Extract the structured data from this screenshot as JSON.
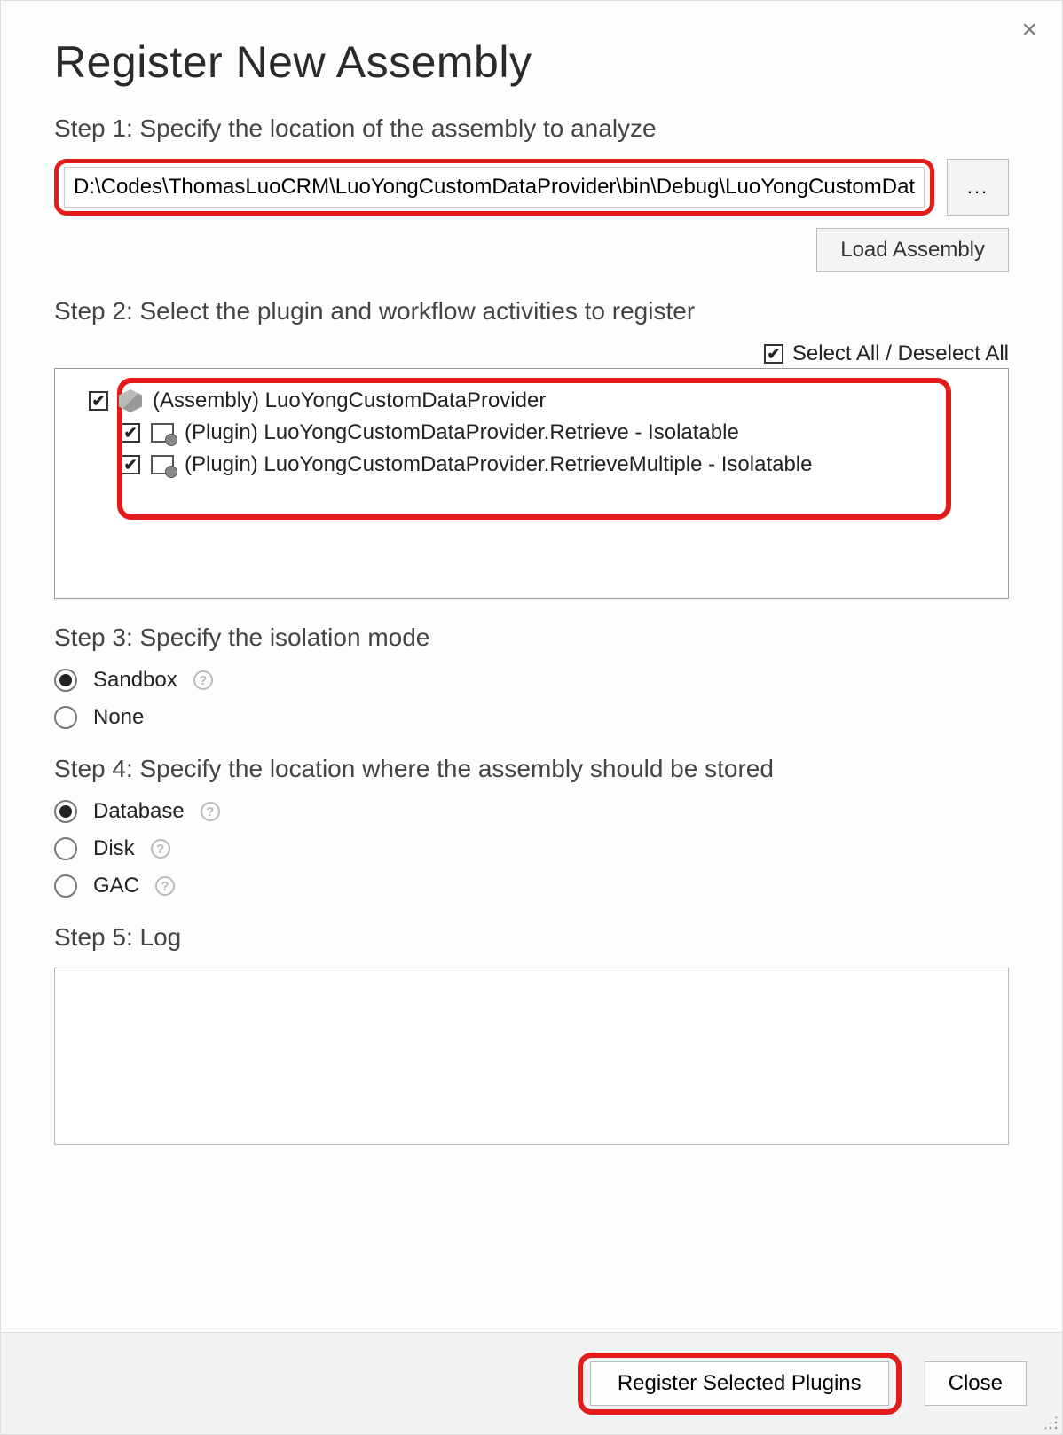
{
  "title": "Register New Assembly",
  "close_x": "×",
  "step1": {
    "label": "Step 1: Specify the location of the assembly to analyze",
    "path": "D:\\Codes\\ThomasLuoCRM\\LuoYongCustomDataProvider\\bin\\Debug\\LuoYongCustomDataProv",
    "browse": "...",
    "load_button": "Load Assembly"
  },
  "step2": {
    "label": "Step 2: Select the plugin and workflow activities to register",
    "select_all_label": "Select All / Deselect All",
    "select_all_checked": true,
    "tree": {
      "assembly": {
        "checked": true,
        "label": "(Assembly) LuoYongCustomDataProvider"
      },
      "plugins": [
        {
          "checked": true,
          "label": "(Plugin) LuoYongCustomDataProvider.Retrieve - Isolatable"
        },
        {
          "checked": true,
          "label": "(Plugin) LuoYongCustomDataProvider.RetrieveMultiple - Isolatable"
        }
      ]
    }
  },
  "step3": {
    "label": "Step 3: Specify the isolation mode",
    "options": [
      {
        "label": "Sandbox",
        "selected": true,
        "help": true
      },
      {
        "label": "None",
        "selected": false,
        "help": false
      }
    ]
  },
  "step4": {
    "label": "Step 4: Specify the location where the assembly should be stored",
    "options": [
      {
        "label": "Database",
        "selected": true,
        "help": true
      },
      {
        "label": "Disk",
        "selected": false,
        "help": true
      },
      {
        "label": "GAC",
        "selected": false,
        "help": true
      }
    ]
  },
  "step5": {
    "label": "Step 5: Log",
    "log_text": ""
  },
  "footer": {
    "register": "Register Selected Plugins",
    "close": "Close"
  },
  "help_glyph": "?",
  "check_glyph": "✔"
}
